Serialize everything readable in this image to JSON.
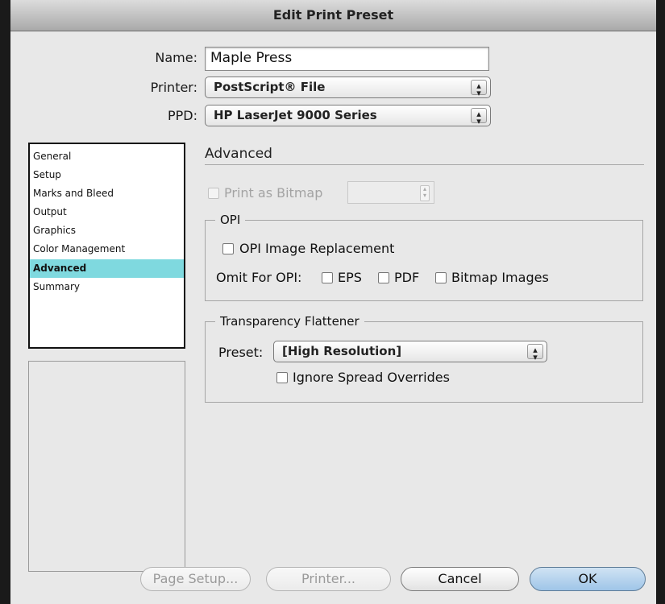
{
  "window": {
    "title": "Edit Print Preset"
  },
  "fields": {
    "name_label": "Name:",
    "name_value": "Maple Press",
    "printer_label": "Printer:",
    "printer_value": "PostScript® File",
    "ppd_label": "PPD:",
    "ppd_value": "HP LaserJet 9000 Series"
  },
  "sidebar": {
    "items": [
      {
        "label": "General",
        "selected": false
      },
      {
        "label": "Setup",
        "selected": false
      },
      {
        "label": "Marks and Bleed",
        "selected": false
      },
      {
        "label": "Output",
        "selected": false
      },
      {
        "label": "Graphics",
        "selected": false
      },
      {
        "label": "Color Management",
        "selected": false
      },
      {
        "label": "Advanced",
        "selected": true
      },
      {
        "label": "Summary",
        "selected": false
      }
    ]
  },
  "panel": {
    "heading": "Advanced",
    "print_as_bitmap": {
      "label": "Print as Bitmap",
      "checked": false,
      "enabled": false
    },
    "opi": {
      "group_label": "OPI",
      "image_replacement": {
        "label": "OPI Image Replacement",
        "checked": false
      },
      "omit_label": "Omit For OPI:",
      "omit_eps": {
        "label": "EPS",
        "checked": false
      },
      "omit_pdf": {
        "label": "PDF",
        "checked": false
      },
      "omit_bitmap": {
        "label": "Bitmap Images",
        "checked": false
      }
    },
    "flattener": {
      "group_label": "Transparency Flattener",
      "preset_label": "Preset:",
      "preset_value": "[High Resolution]",
      "ignore_overrides": {
        "label": "Ignore Spread Overrides",
        "checked": false
      }
    }
  },
  "buttons": {
    "page_setup": "Page Setup...",
    "printer": "Printer...",
    "cancel": "Cancel",
    "ok": "OK"
  },
  "colors": {
    "selection": "#7fd9df",
    "window_bg": "#e8e8e8",
    "ok_button": "#9fc5e8"
  }
}
